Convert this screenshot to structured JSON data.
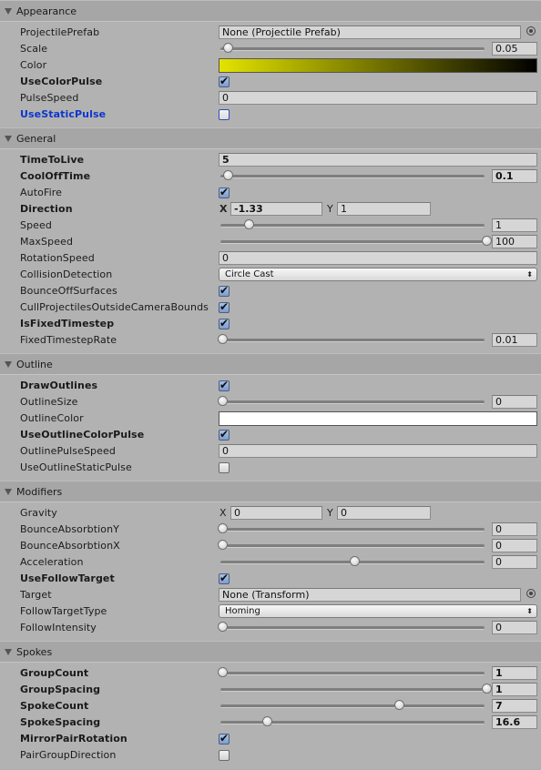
{
  "sections": {
    "appearance": {
      "title": "Appearance",
      "projectile_prefab": {
        "label": "ProjectilePrefab",
        "value": "None (Projectile Prefab)",
        "picker_icon": "object-picker-icon"
      },
      "scale": {
        "label": "Scale",
        "value": "0.05",
        "fraction": 0.02
      },
      "color": {
        "label": "Color",
        "gradient_start": "#e3e300",
        "gradient_end": "#000000"
      },
      "use_color_pulse": {
        "label": "UseColorPulse",
        "checked": true
      },
      "pulse_speed": {
        "label": "PulseSpeed",
        "value": "0"
      },
      "use_static_pulse": {
        "label": "UseStaticPulse",
        "checked": false
      }
    },
    "general": {
      "title": "General",
      "time_to_live": {
        "label": "TimeToLive",
        "value": "5"
      },
      "cool_off_time": {
        "label": "CoolOffTime",
        "value": "0.1",
        "fraction": 0.02
      },
      "auto_fire": {
        "label": "AutoFire",
        "checked": true
      },
      "direction": {
        "label": "Direction",
        "x_label": "X",
        "x": "-1.33",
        "y_label": "Y",
        "y": "1"
      },
      "speed": {
        "label": "Speed",
        "value": "1",
        "fraction": 0.1
      },
      "max_speed": {
        "label": "MaxSpeed",
        "value": "100",
        "fraction": 1.0
      },
      "rotation_speed": {
        "label": "RotationSpeed",
        "value": "0"
      },
      "collision_detection": {
        "label": "CollisionDetection",
        "value": "Circle Cast"
      },
      "bounce_off_surfaces": {
        "label": "BounceOffSurfaces",
        "checked": true
      },
      "cull_projectiles": {
        "label": "CullProjectilesOutsideCameraBounds",
        "checked": true
      },
      "is_fixed_timestep": {
        "label": "IsFixedTimestep",
        "checked": true
      },
      "fixed_timestep_rate": {
        "label": "FixedTimestepRate",
        "value": "0.01",
        "fraction": 0.0
      }
    },
    "outline": {
      "title": "Outline",
      "draw_outlines": {
        "label": "DrawOutlines",
        "checked": true
      },
      "outline_size": {
        "label": "OutlineSize",
        "value": "0",
        "fraction": 0.0
      },
      "outline_color": {
        "label": "OutlineColor",
        "color": "#ffffff"
      },
      "use_outline_color_pulse": {
        "label": "UseOutlineColorPulse",
        "checked": true
      },
      "outline_pulse_speed": {
        "label": "OutlinePulseSpeed",
        "value": "0"
      },
      "use_outline_static_pulse": {
        "label": "UseOutlineStaticPulse",
        "checked": false
      }
    },
    "modifiers": {
      "title": "Modifiers",
      "gravity": {
        "label": "Gravity",
        "x_label": "X",
        "x": "0",
        "y_label": "Y",
        "y": "0"
      },
      "bounce_absorbtion_y": {
        "label": "BounceAbsorbtionY",
        "value": "0",
        "fraction": 0.0
      },
      "bounce_absorbtion_x": {
        "label": "BounceAbsorbtionX",
        "value": "0",
        "fraction": 0.0
      },
      "acceleration": {
        "label": "Acceleration",
        "value": "0",
        "fraction": 0.5
      },
      "use_follow_target": {
        "label": "UseFollowTarget",
        "checked": true
      },
      "target": {
        "label": "Target",
        "value": "None (Transform)",
        "picker_icon": "object-picker-icon"
      },
      "follow_target_type": {
        "label": "FollowTargetType",
        "value": "Homing"
      },
      "follow_intensity": {
        "label": "FollowIntensity",
        "value": "0",
        "fraction": 0.0
      }
    },
    "spokes": {
      "title": "Spokes",
      "group_count": {
        "label": "GroupCount",
        "value": "1",
        "fraction": 0.0
      },
      "group_spacing": {
        "label": "GroupSpacing",
        "value": "1",
        "fraction": 1.0
      },
      "spoke_count": {
        "label": "SpokeCount",
        "value": "7",
        "fraction": 0.67
      },
      "spoke_spacing": {
        "label": "SpokeSpacing",
        "value": "16.6",
        "fraction": 0.17
      },
      "mirror_pair_rotation": {
        "label": "MirrorPairRotation",
        "checked": true
      },
      "pair_group_direction": {
        "label": "PairGroupDirection",
        "checked": false
      }
    }
  }
}
